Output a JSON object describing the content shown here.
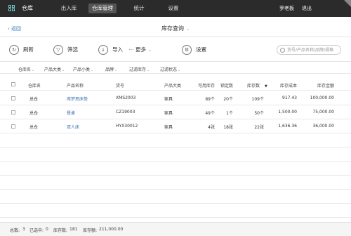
{
  "app_title": "仓库",
  "nav": [
    "出入库",
    "仓库管理",
    "统计",
    "设置"
  ],
  "user": "罗老板",
  "logout": "退出",
  "back": "返回",
  "page_title": "库存查询",
  "toolbar": {
    "refresh": "刷新",
    "filter": "筛选",
    "import": "导入",
    "more": "更多",
    "settings": "设置"
  },
  "search_placeholder": "货号/产品名称/品牌/规格",
  "filters": [
    "仓库名",
    "产品大类",
    "产品小类",
    "品牌",
    "过滤库存",
    "过滤状态"
  ],
  "columns": [
    "仓库名",
    "产品名称",
    "货号",
    "产品大类",
    "可用库存",
    "锁定数",
    "库存数",
    "库存成本",
    "库存金额"
  ],
  "rows": [
    {
      "warehouse": "总仓",
      "name": "席梦思床垫",
      "sku": "XMS2003",
      "category": "家具",
      "available": "89个",
      "locked": "20个",
      "stock": "109个",
      "cost": "917.43",
      "amount": "100,000.00"
    },
    {
      "warehouse": "总仓",
      "name": "餐桌",
      "sku": "CZ19003",
      "category": "家具",
      "available": "49个",
      "locked": "1个",
      "stock": "50个",
      "cost": "1,500.00",
      "amount": "75,000.00"
    },
    {
      "warehouse": "总仓",
      "name": "双人床",
      "sku": "HYX30012",
      "category": "家具",
      "available": "4张",
      "locked": "18张",
      "stock": "22张",
      "cost": "1,636.36",
      "amount": "36,000.00"
    }
  ],
  "footer": {
    "total_label": "总数:",
    "total": "3",
    "selected_label": "已选中:",
    "selected": "0",
    "stock_label": "库存数:",
    "stock": "181",
    "value_label": "库存额:",
    "value": "211,000.00"
  }
}
